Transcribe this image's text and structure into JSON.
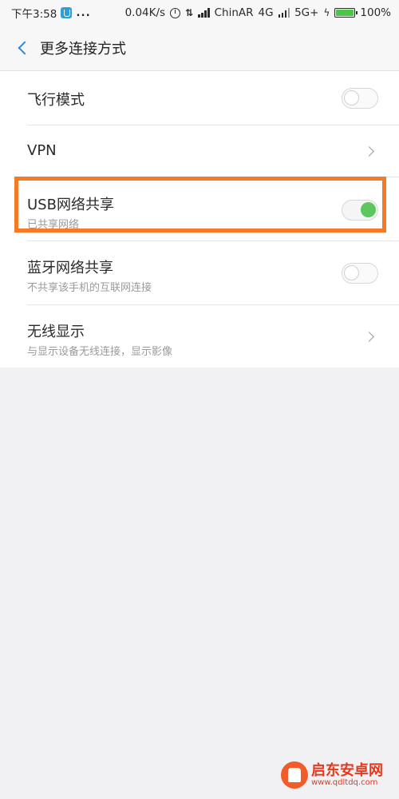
{
  "status_bar": {
    "time": "下午3:58",
    "dots": "...",
    "speed": "0.04K/s",
    "carrier": "ChinAR",
    "network1": "4G",
    "network2": "5G+",
    "battery": "100%",
    "battery_color": "#4cc64a"
  },
  "header": {
    "title": "更多连接方式",
    "back_icon": "chevron-left-icon",
    "accent_color": "#2a8ad8"
  },
  "settings": [
    {
      "title": "飞行模式",
      "subtitle": "",
      "control": "toggle",
      "on": false
    },
    {
      "title": "VPN",
      "subtitle": "",
      "control": "chevron",
      "on": false
    },
    {
      "title": "USB网络共享",
      "subtitle": "已共享网络",
      "control": "toggle",
      "on": true
    },
    {
      "title": "蓝牙网络共享",
      "subtitle": "不共享该手机的互联网连接",
      "control": "toggle",
      "on": false
    },
    {
      "title": "无线显示",
      "subtitle": "与显示设备无线连接，显示影像",
      "control": "chevron",
      "on": false
    }
  ],
  "colors": {
    "toggle_on": "#5cc75e",
    "highlight": "#f57a23"
  },
  "watermark": {
    "title": "启东安卓网",
    "url": "www.qdltdq.com"
  }
}
